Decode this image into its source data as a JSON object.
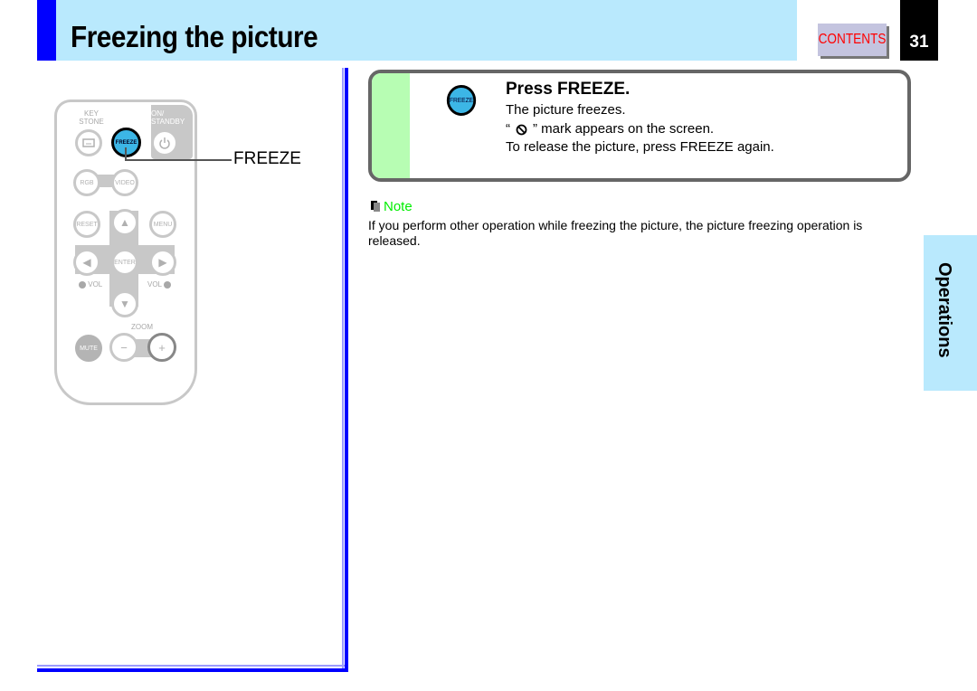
{
  "header": {
    "title": "Freezing the picture",
    "contents_label": "CONTENTS",
    "page_number": "31"
  },
  "colors": {
    "header_bg": "#b9e9fd",
    "accent_blue": "#0000ff",
    "freeze_button": "#3cb6e6",
    "step_green": "#b7fdb3",
    "note_green": "#00ee00",
    "contents_red": "#ff0000"
  },
  "remote": {
    "labels": {
      "keystone": "KEY STONE",
      "on_standby": "ON/ STANDBY",
      "freeze": "FREEZE",
      "rgb": "RGB",
      "video": "VIDEO",
      "reset": "RESET",
      "menu": "MENU",
      "enter": "ENTER",
      "vol_minus": "VOL",
      "vol_plus": "VOL",
      "zoom": "ZOOM",
      "mute": "MUTE",
      "zoom_minus": "−",
      "zoom_plus": "+"
    },
    "callout_label": "FREEZE"
  },
  "step": {
    "icon_label": "FREEZE",
    "title": "Press FREEZE.",
    "line1": "The picture freezes.",
    "line2_prefix": "“",
    "line2_suffix": "” mark appears on the screen.",
    "line3": "To release the picture, press FREEZE again."
  },
  "note": {
    "label": "Note",
    "text": "If you perform other operation while freezing the picture, the picture freezing operation is released."
  },
  "side_tab": {
    "label": "Operations"
  }
}
